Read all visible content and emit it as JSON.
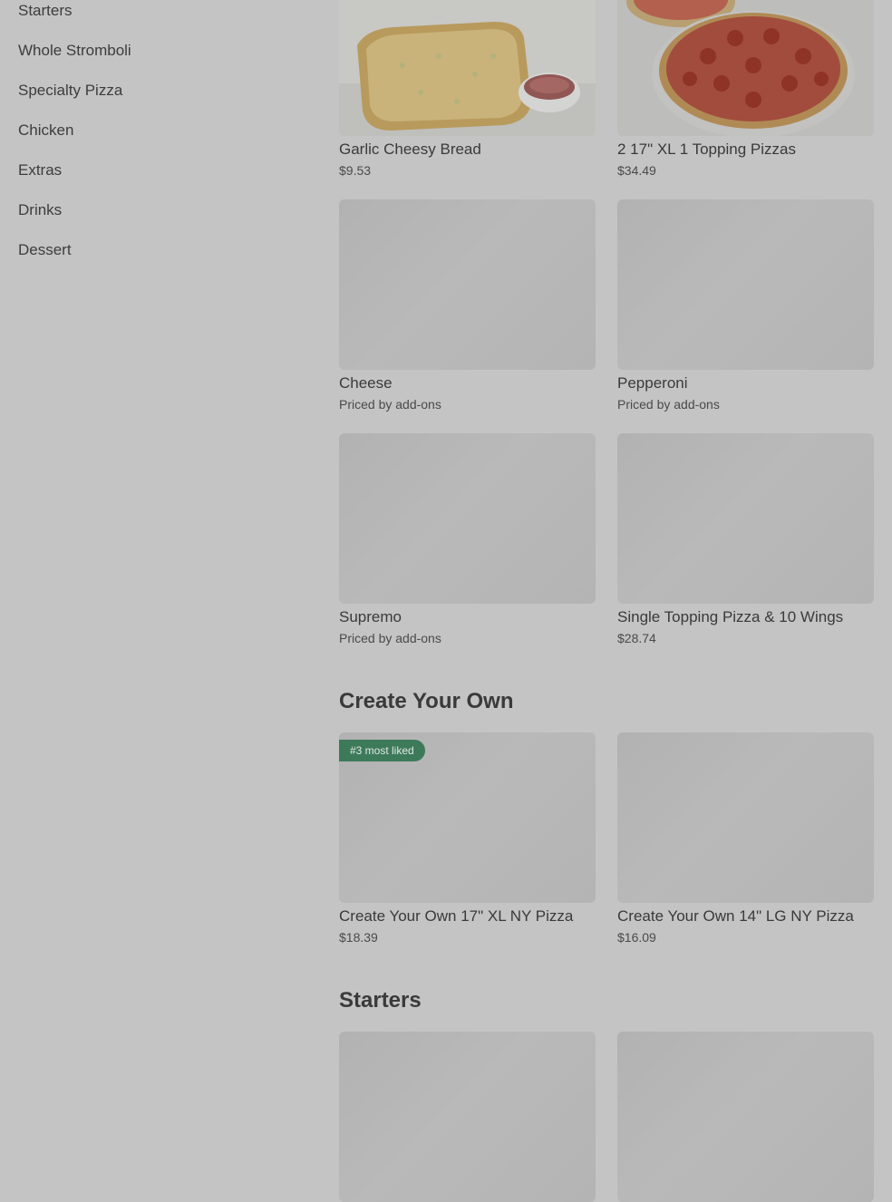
{
  "sidebar": {
    "categories": [
      "Starters",
      "Whole Stromboli",
      "Specialty Pizza",
      "Chicken",
      "Extras",
      "Drinks",
      "Dessert"
    ]
  },
  "top_items": [
    {
      "title": "Garlic Cheesy Bread",
      "price": "$9.53"
    },
    {
      "title": "2 17\" XL 1 Topping Pizzas",
      "price": "$34.49"
    },
    {
      "title": "Cheese",
      "price": "Priced by add-ons"
    },
    {
      "title": "Pepperoni",
      "price": "Priced by add-ons"
    },
    {
      "title": "Supremo",
      "price": "Priced by add-ons"
    },
    {
      "title": "Single Topping Pizza & 10 Wings",
      "price": "$28.74"
    }
  ],
  "create_your_own": {
    "heading": "Create Your Own",
    "badge": "#3 most liked",
    "items": [
      {
        "title": "Create Your Own 17\" XL NY Pizza",
        "price": "$18.39"
      },
      {
        "title": "Create Your Own 14\" LG NY Pizza",
        "price": "$16.09"
      }
    ]
  },
  "starters": {
    "heading": "Starters"
  },
  "colors": {
    "overlay_bg": "#c4c4c4",
    "badge_bg": "#3d7a5a",
    "text": "#3a3a3a"
  }
}
